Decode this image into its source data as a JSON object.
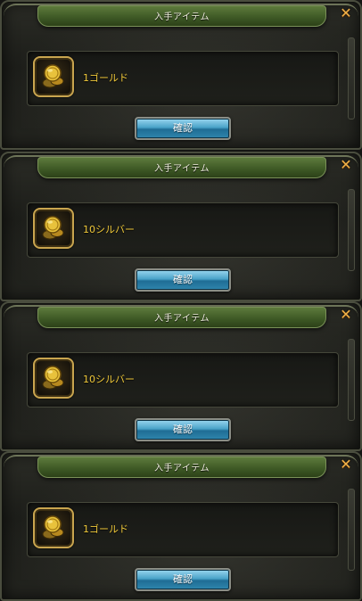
{
  "dialogs": [
    {
      "title": "入手アイテム",
      "item_name": "1ゴールド",
      "confirm_label": "確認",
      "close_label": "✕"
    },
    {
      "title": "入手アイテム",
      "item_name": "10シルバー",
      "confirm_label": "確認",
      "close_label": "✕"
    },
    {
      "title": "入手アイテム",
      "item_name": "10シルバー",
      "confirm_label": "確認",
      "close_label": "✕"
    },
    {
      "title": "入手アイテム",
      "item_name": "1ゴールド",
      "confirm_label": "確認",
      "close_label": "✕"
    }
  ],
  "icons": {
    "item": "gold-coins-icon",
    "close": "close-icon"
  },
  "colors": {
    "title_bar": "#4a6a2e",
    "item_text": "#f0c93a",
    "confirm_button": "#3f95bf",
    "close_icon": "#f0b24a",
    "icon_border": "#c9a54f"
  }
}
